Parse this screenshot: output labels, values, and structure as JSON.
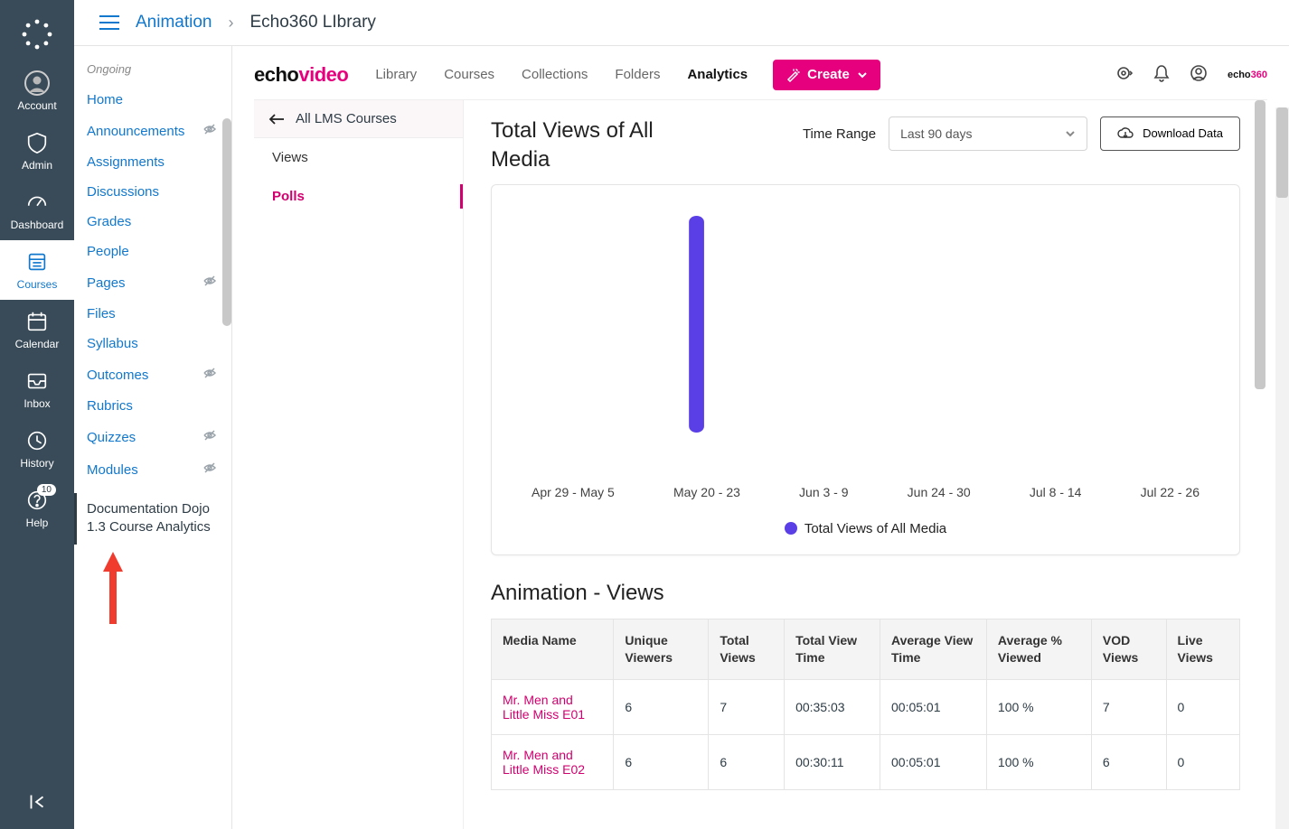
{
  "global_nav": {
    "items": [
      {
        "label": "Account"
      },
      {
        "label": "Admin"
      },
      {
        "label": "Dashboard"
      },
      {
        "label": "Courses"
      },
      {
        "label": "Calendar"
      },
      {
        "label": "Inbox"
      },
      {
        "label": "History"
      },
      {
        "label": "Help",
        "badge": "10"
      }
    ]
  },
  "breadcrumb": {
    "course": "Animation",
    "page": "Echo360 LIbrary"
  },
  "course_sidebar": {
    "section": "Ongoing",
    "items": [
      {
        "label": "Home",
        "hidden": false
      },
      {
        "label": "Announcements",
        "hidden": true
      },
      {
        "label": "Assignments",
        "hidden": false
      },
      {
        "label": "Discussions",
        "hidden": false
      },
      {
        "label": "Grades",
        "hidden": false
      },
      {
        "label": "People",
        "hidden": false
      },
      {
        "label": "Pages",
        "hidden": true
      },
      {
        "label": "Files",
        "hidden": false
      },
      {
        "label": "Syllabus",
        "hidden": false
      },
      {
        "label": "Outcomes",
        "hidden": true
      },
      {
        "label": "Rubrics",
        "hidden": false
      },
      {
        "label": "Quizzes",
        "hidden": true
      },
      {
        "label": "Modules",
        "hidden": true
      }
    ],
    "active": "Documentation Dojo 1.3 Course Analytics"
  },
  "echo": {
    "logo1": "echo",
    "logo2": "video",
    "nav": [
      "Library",
      "Courses",
      "Collections",
      "Folders",
      "Analytics"
    ],
    "nav_active": "Analytics",
    "create": "Create",
    "back": "All LMS Courses",
    "tabs": [
      "Views",
      "Polls"
    ],
    "tab_active": "Polls",
    "panel_title": "Total Views of All Media",
    "time_range_label": "Time Range",
    "time_range_value": "Last 90 days",
    "download": "Download Data",
    "legend": "Total Views of All Media",
    "section_title": "Animation - Views",
    "mini1": "echo",
    "mini2": "360"
  },
  "chart_data": {
    "type": "bar",
    "categories": [
      "Apr 29 - May 5",
      "May 20 - 23",
      "Jun 3 - 9",
      "Jun 24 - 30",
      "Jul 8 - 14",
      "Jul 22 - 26"
    ],
    "values": [
      0,
      100,
      0,
      0,
      0,
      0
    ],
    "series_name": "Total Views of All Media",
    "color": "#5b3fe6",
    "ylim": [
      0,
      100
    ],
    "title": "Total Views of All Media",
    "xlabel": "",
    "ylabel": ""
  },
  "table": {
    "columns": [
      "Media Name",
      "Unique Viewers",
      "Total Views",
      "Total View Time",
      "Average View Time",
      "Average % Viewed",
      "VOD Views",
      "Live Views"
    ],
    "rows": [
      {
        "name": "Mr. Men and Little Miss E01",
        "unique": "6",
        "total": "7",
        "tvt": "00:35:03",
        "avt": "00:05:01",
        "pct": "100 %",
        "vod": "7",
        "live": "0"
      },
      {
        "name": "Mr. Men and Little Miss E02",
        "unique": "6",
        "total": "6",
        "tvt": "00:30:11",
        "avt": "00:05:01",
        "pct": "100 %",
        "vod": "6",
        "live": "0"
      }
    ]
  }
}
